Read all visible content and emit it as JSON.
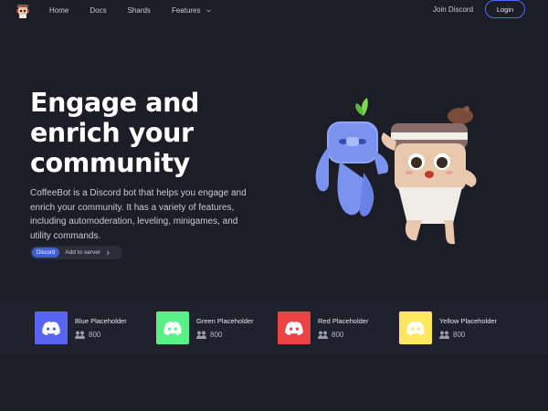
{
  "nav": {
    "links": [
      "Home",
      "Docs",
      "Shards",
      "Features"
    ],
    "join_label": "Join Discord",
    "login_label": "Login"
  },
  "hero": {
    "title_lines": [
      "Engage and",
      "enrich your",
      "community"
    ],
    "description": "CoffeeBot is a Discord bot that helps you engage and enrich your community. It has a variety of features, including automoderation, leveling, minigames, and utility commands.",
    "badge": "Discord",
    "cta": "Add to server"
  },
  "servers": [
    {
      "name": "Blue Placeholder",
      "count": "800",
      "color": "#5865f2"
    },
    {
      "name": "Green Placeholder",
      "count": "800",
      "color": "#57f287"
    },
    {
      "name": "Red Placeholder",
      "count": "800",
      "color": "#ed4245"
    },
    {
      "name": "Yellow Placeholder",
      "count": "800",
      "color": "#fee75c"
    }
  ],
  "colors": {
    "background": "#1c1d26",
    "accent": "#4b6bf5",
    "strip": "#20212c"
  }
}
